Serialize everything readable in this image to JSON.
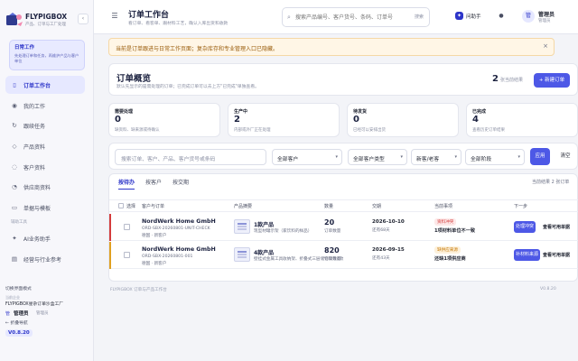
{
  "brand": {
    "name": "FLYPIGBOX",
    "subtitle": "产品、订单与工厂处理",
    "collapse_icon": "chevron-left-icon"
  },
  "sidebar": {
    "work_card": {
      "title": "日常工作",
      "desc": "先处理订单和任务，再维护产品与客户单位"
    },
    "items": [
      {
        "label": "订单工作台",
        "icon": "inbox-icon",
        "glyph": "▯",
        "active": true
      },
      {
        "label": "我的工作",
        "icon": "target-icon",
        "glyph": "◉",
        "active": false
      },
      {
        "label": "跟续任务",
        "icon": "refresh-icon",
        "glyph": "↻",
        "active": false
      },
      {
        "label": "产品资料",
        "icon": "box-icon",
        "glyph": "◇",
        "active": false
      },
      {
        "label": "客户资料",
        "icon": "user-icon",
        "glyph": "◌",
        "active": false
      },
      {
        "label": "供应商资料",
        "icon": "factory-icon",
        "glyph": "◔",
        "active": false
      },
      {
        "label": "单据与模板",
        "icon": "document-icon",
        "glyph": "▭",
        "active": false
      }
    ],
    "section_tools": "辅助工具",
    "tools": [
      {
        "label": "AI业务助手",
        "icon": "ai-icon",
        "glyph": "✦"
      },
      {
        "label": "经营与行业参考",
        "icon": "chart-icon",
        "glyph": "▤"
      }
    ],
    "footer": {
      "mode": "切换界面模式",
      "corp_label": "当前企业",
      "corp": "FLYPIGBOX星杂订单沙盒工厂",
      "user": "管理员",
      "role": "管理员",
      "collapse": "折叠导航",
      "version": "V0.8.20"
    }
  },
  "topbar": {
    "menu_icon": "menu-icon",
    "title": "订单工作台",
    "subtitle": "看订单、看客单、跟材料工艺，确认入库出货和收款",
    "search_placeholder": "搜索产品编号、客户货号、条码、订单号",
    "search_button": "搜索",
    "assistant": "问助手",
    "user": {
      "avatar": "管",
      "name": "管理员",
      "role": "管理员"
    }
  },
  "notice": {
    "text": "当前是订单跟进与日常工作页面；复杂库存和专业管理入口已隐藏。",
    "close": "×"
  },
  "overview": {
    "title": "订单概览",
    "desc": "默认先显示的是需处理的订单；已完成订单可以去上方\"已完成\"单独查看。",
    "count": "2",
    "count_label": "张当前结果",
    "new_button": "+ 新建订单"
  },
  "stats": [
    {
      "label": "需要处理",
      "value": "0",
      "desc": "缺资料、缺来源或待确认"
    },
    {
      "label": "生产中",
      "value": "2",
      "desc": "内部或外厂正在处理"
    },
    {
      "label": "待发货",
      "value": "0",
      "desc": "已经可以安排出货"
    },
    {
      "label": "已完成",
      "value": "4",
      "desc": "查看历史订单结果"
    }
  ],
  "filters": {
    "search_placeholder": "搜索订单、客户、产品、客户货号或条码",
    "selects": [
      "全部客户",
      "全部客户类型",
      "新客/老客",
      "全部阶段"
    ],
    "apply": "应用",
    "clear": "清空"
  },
  "table": {
    "tabs": [
      "按待办",
      "按客户",
      "按交期"
    ],
    "count_text": "当前结果 2 张订单",
    "headers": [
      "选择",
      "客户与订单",
      "产品摘要",
      "数量",
      "交期",
      "当前事项",
      "下一步"
    ],
    "rows": [
      {
        "customer": "NordWerk Home GmbH",
        "ref": "ORD-SBX-20260801-UNIT-CHECK",
        "loc": "德国 · 新客户",
        "product": "1款产品",
        "product_desc": "现型材罐示架（家饮料的样品）",
        "qty": "20",
        "qty_label": "订单数量",
        "date": "2026-10-10",
        "date_desc": "还有68天",
        "badge": "资料冲突",
        "badge_color": "#d43c3c",
        "issue": "1项材料单位不一致",
        "action": "处理冲突",
        "action2": "查看可用单据",
        "bar_color": "#d43c3c"
      },
      {
        "customer": "NordWerk Home GmbH",
        "ref": "ORD-SBX-20260801-001",
        "loc": "德国 · 新客户",
        "product": "4款产品",
        "product_desc": "壁挂式金属工具收纳架、折叠式三层储物架等4款",
        "qty": "820",
        "qty_label": "订单数量",
        "date": "2026-09-15",
        "date_desc": "还有43天",
        "badge": "缺供应来源",
        "badge_color": "#d98a10",
        "issue": "还缺1项供应商",
        "action": "补材料来源",
        "action2": "查看可用单据",
        "bar_color": "#e0a020"
      }
    ]
  },
  "footer": {
    "left": "FLYPIGBOX 订单与产品工作台",
    "right": "V0.8.20"
  },
  "colors": {
    "accent": "#4d58e6",
    "danger": "#d43c3c",
    "warning": "#e0a020"
  }
}
